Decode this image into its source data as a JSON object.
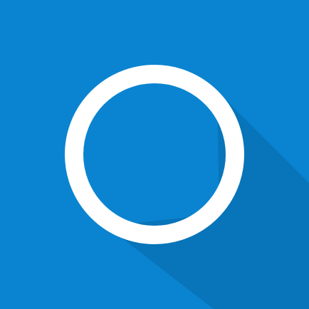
{
  "tile": {
    "background_color": "#0a84d0",
    "shadow_color": "#0872b6",
    "ring_color": "#ffffff",
    "icon": "circle-ring-icon"
  }
}
